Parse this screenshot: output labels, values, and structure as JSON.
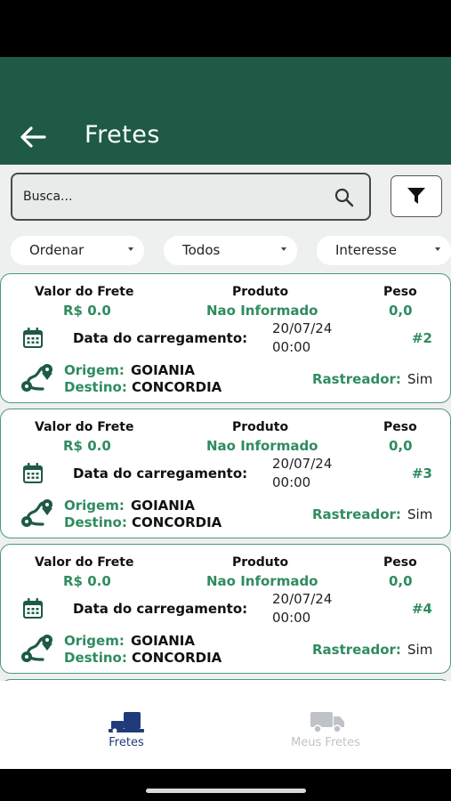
{
  "header": {
    "title": "Fretes"
  },
  "search": {
    "placeholder": "Busca..."
  },
  "filters": {
    "ordenar": "Ordenar",
    "todos": "Todos",
    "interesse": "Interesse"
  },
  "labels": {
    "valor": "Valor do Frete",
    "produto": "Produto",
    "peso": "Peso",
    "data": "Data do carregamento:",
    "origem": "Origem:",
    "destino": "Destino:",
    "rastreador": "Rastreador:"
  },
  "cards": [
    {
      "valor": "R$ 0.0",
      "produto": "Nao Informado",
      "peso": "0,0",
      "date": "20/07/24",
      "time": "00:00",
      "id": "#2",
      "origem": "GOIANIA",
      "destino": "CONCORDIA",
      "rastreador": "Sim"
    },
    {
      "valor": "R$ 0.0",
      "produto": "Nao Informado",
      "peso": "0,0",
      "date": "20/07/24",
      "time": "00:00",
      "id": "#3",
      "origem": "GOIANIA",
      "destino": "CONCORDIA",
      "rastreador": "Sim"
    },
    {
      "valor": "R$ 0.0",
      "produto": "Nao Informado",
      "peso": "0,0",
      "date": "20/07/24",
      "time": "00:00",
      "id": "#4",
      "origem": "GOIANIA",
      "destino": "CONCORDIA",
      "rastreador": "Sim"
    }
  ],
  "nav": {
    "fretes": "Fretes",
    "meus_fretes": "Meus Fretes"
  },
  "colors": {
    "header": "#1e5a45",
    "accent": "#2f8c5f",
    "nav_active": "#1f3b7a",
    "nav_inactive": "#bfc3c7"
  },
  "icons": [
    "back-arrow-icon",
    "search-icon",
    "filter-icon",
    "caret-down-icon",
    "calendar-icon",
    "route-icon",
    "fretes-icon",
    "truck-icon"
  ]
}
